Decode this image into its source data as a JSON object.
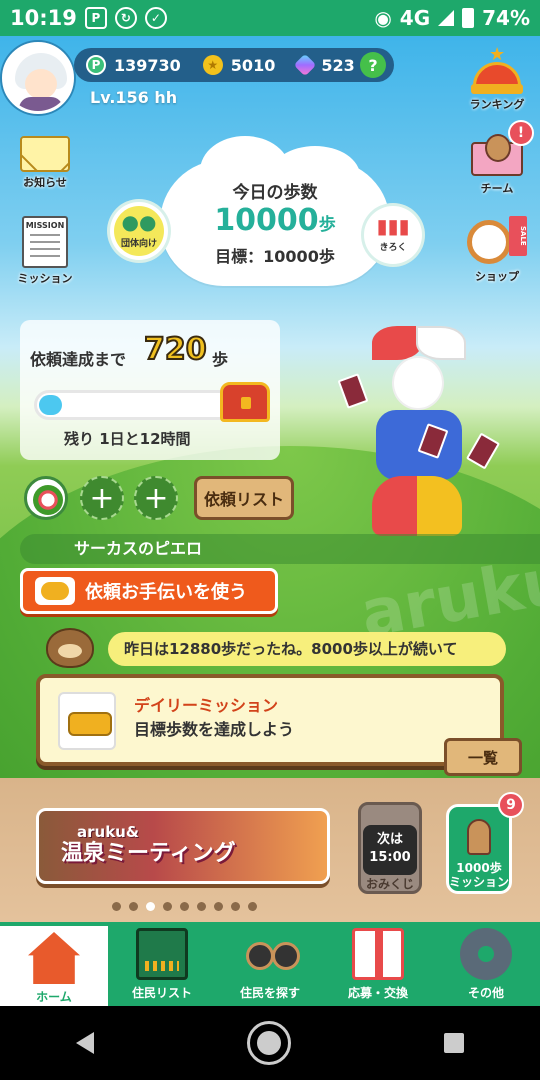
{
  "status_bar": {
    "time": "10:19",
    "network": "4G",
    "battery": "74%"
  },
  "profile": {
    "points": "139730",
    "coins": "5010",
    "gems": "523",
    "help_symbol": "?",
    "level": "Lv.156 hh"
  },
  "side": {
    "notices": "お知らせ",
    "mission": "ミッション",
    "mission_card": "MISSION",
    "ranking": "ランキング",
    "team": "チーム",
    "team_badge": "!",
    "shop": "ショップ",
    "shop_tag": "SALE"
  },
  "steps": {
    "title": "今日の歩数",
    "value": "10000",
    "unit": "歩",
    "goal": "目標：10000歩",
    "group_btn": "団体向け",
    "record_btn": "きろく"
  },
  "request": {
    "label": "依頼達成まで",
    "remaining": "720",
    "unit": "歩",
    "progress": 0.12,
    "time_left_prefix": "残り ",
    "time_left": "1日と12時間",
    "list_button": "依頼リスト",
    "add_symbol": "+",
    "character_name": "サーカスのピエロ",
    "use_help_button": "依頼お手伝いを使う"
  },
  "message": "昨日は12880歩だったね。8000歩以上が続いて",
  "daily_mission": {
    "title": "デイリーミッション",
    "desc": "目標歩数を達成しよう",
    "list_button": "一覧"
  },
  "bottom_panel": {
    "banner_top": "aruku&",
    "banner_main": "温泉ミーティング",
    "omikuji_next": "次は",
    "omikuji_time": "15:00",
    "omikuji_label": "おみくじ",
    "steps_mission_badge": "9",
    "steps_mission_label_1": "1000歩",
    "steps_mission_label_2": "ミッション",
    "carousel_count": 9,
    "carousel_active": 2
  },
  "nav": [
    {
      "label": "ホーム",
      "icon": "house-icon",
      "active": true
    },
    {
      "label": "住民リスト",
      "icon": "book-icon",
      "active": false
    },
    {
      "label": "住民を探す",
      "icon": "binoculars-icon",
      "active": false
    },
    {
      "label": "応募・交換",
      "icon": "gift-icon",
      "active": false
    },
    {
      "label": "その他",
      "icon": "gear-icon",
      "active": false
    }
  ],
  "watermark": "aruku&"
}
